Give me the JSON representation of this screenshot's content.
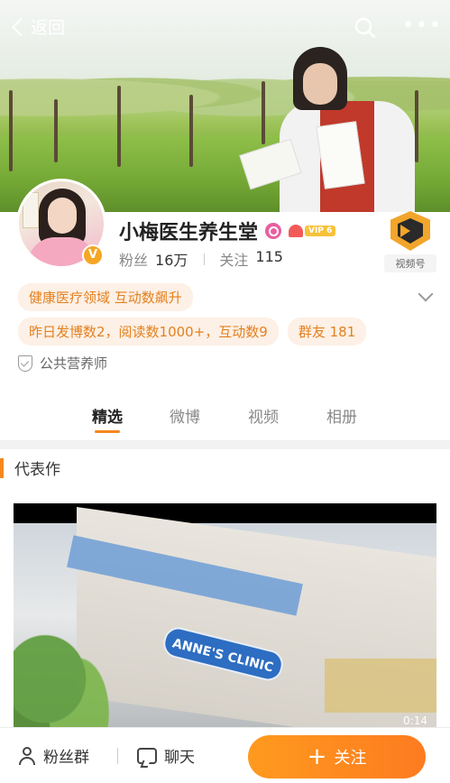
{
  "header": {
    "back_label": "返回",
    "search_icon": "search-icon",
    "more_icon": "more-icon",
    "more_glyph": "•••"
  },
  "profile": {
    "name": "小梅医生养生堂",
    "vip_label": "VIP 6",
    "verified_glyph": "V",
    "fans_label": "粉丝",
    "fans_count": "16万",
    "following_label": "关注",
    "following_count": "115",
    "channel_label": "视频号"
  },
  "tags": {
    "domain": "健康医疗领域 互动数飙升",
    "activity": "昨日发博数2，阅读数1000+，互动数9",
    "group": "群友 181",
    "certification": "公共营养师"
  },
  "tabs": [
    {
      "label": "精选",
      "active": true
    },
    {
      "label": "微博",
      "active": false
    },
    {
      "label": "视频",
      "active": false
    },
    {
      "label": "相册",
      "active": false
    }
  ],
  "section": {
    "title": "代表作"
  },
  "video": {
    "sign_text": "ANNE'S CLINIC",
    "duration": "0:14"
  },
  "bottom_bar": {
    "fans_group_label": "粉丝群",
    "chat_label": "聊天",
    "follow_label": "关注",
    "follow_glyph": "+"
  },
  "colors": {
    "accent": "#f5871f",
    "tag_bg": "#fdf0e6",
    "tag_text": "#e4801e",
    "follow_button": "#fd7b20"
  }
}
